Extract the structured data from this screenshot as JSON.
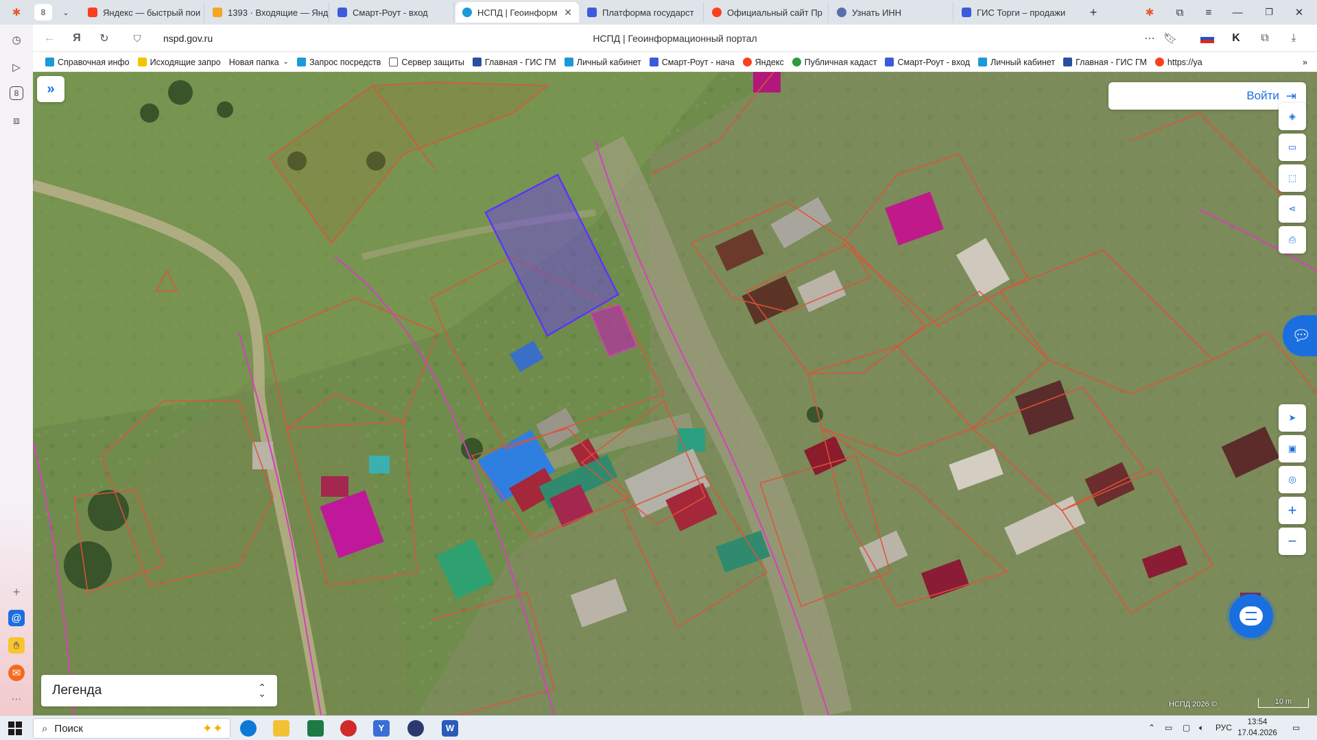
{
  "browser": {
    "tab_count": "8",
    "tabs": [
      {
        "label": "Яндекс — быстрый пои",
        "favicon_color": "#fc3f1d",
        "favicon": "yandex-icon"
      },
      {
        "label": "1393 · Входящие — Янд",
        "favicon_color": "#f5a623",
        "favicon": "mail-icon"
      },
      {
        "label": "Смарт-Роут - вход",
        "favicon_color": "#3b5bdb",
        "favicon": "smart-route-icon"
      },
      {
        "label": "НСПД | Геоинформ",
        "favicon_color": "#1a9ad6",
        "favicon": "nspd-icon",
        "active": true
      },
      {
        "label": "Платформа государст",
        "favicon_color": "#3b5bdb",
        "favicon": "gov-platform-icon"
      },
      {
        "label": "Официальный сайт Пр",
        "favicon_color": "#fc3f1d",
        "favicon": "yandex-icon"
      },
      {
        "label": "Узнать ИНН",
        "favicon_color": "#5a6fa8",
        "favicon": "tax-icon"
      },
      {
        "label": "ГИС Торги – продажи",
        "favicon_color": "#3b5bdb",
        "favicon": "torgi-icon"
      }
    ],
    "url": "nspd.gov.ru",
    "page_title": "НСПД | Геоинформационный портал",
    "bookmarks": [
      {
        "label": "Справочная инфо",
        "color": "#1a9ad6"
      },
      {
        "label": "Исходящие запро",
        "color": "#f5c400"
      },
      {
        "label": "Новая папка",
        "color": "",
        "dropdown": true
      },
      {
        "label": "Запрос посредств",
        "color": "#1a9ad6"
      },
      {
        "label": "Сервер защиты",
        "color": "",
        "icon": "page-icon"
      },
      {
        "label": "Главная - ГИС ГМ",
        "color": "#2b4fa0"
      },
      {
        "label": "Личный кабинет",
        "color": "#1a9ad6"
      },
      {
        "label": "Смарт-Роут - нача",
        "color": "#3b5bdb"
      },
      {
        "label": "Яндекс",
        "color": "#fc3f1d"
      },
      {
        "label": "Публичная кадаст",
        "color": "#2e9b3c"
      },
      {
        "label": "Смарт-Роут - вход",
        "color": "#3b5bdb"
      },
      {
        "label": "Личный кабинет",
        "color": "#1a9ad6"
      },
      {
        "label": "Главная - ГИС ГМ",
        "color": "#2b4fa0"
      },
      {
        "label": "https://ya",
        "color": "#fc3f1d"
      }
    ]
  },
  "map": {
    "login_label": "Войти",
    "legend_label": "Легенда",
    "attribution": "НСПД 2026 ©",
    "scale_label": "10 m"
  },
  "taskbar": {
    "search_label": "Поиск",
    "language": "РУС",
    "time": "13:54",
    "date": "17.04.2026"
  },
  "colors": {
    "accent": "#1a6fe0",
    "selected_parcel": "#6a3df0",
    "parcel_border": "#e0523a",
    "boundary": "#d63fbf"
  }
}
